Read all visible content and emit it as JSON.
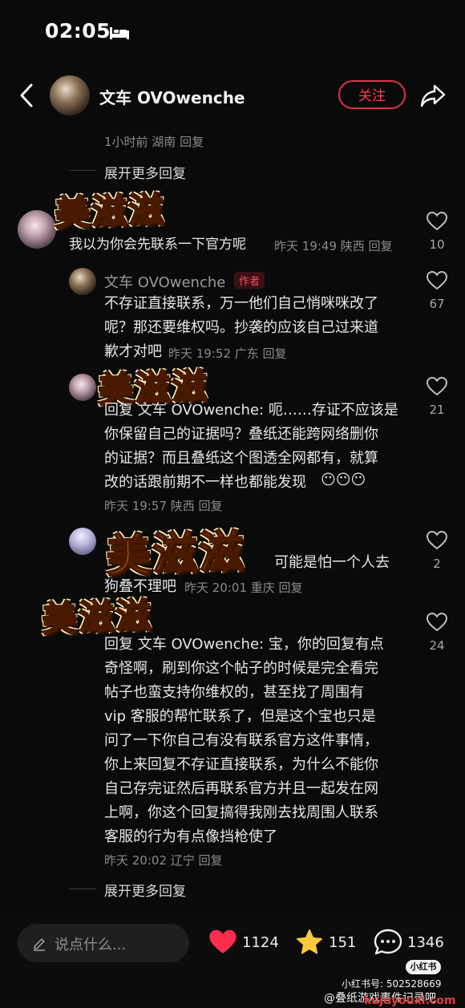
{
  "status": {
    "time": "02:05"
  },
  "header": {
    "name": "文车 OVOwenche",
    "follow": "关注"
  },
  "top_meta": "1小时前 湖南 回复",
  "expand_top": "展开更多回复",
  "comments": [
    {
      "sticker": "美滋滋",
      "text": "我以为你会先联系一下官方呢",
      "meta": "昨天 19:49 陕西 回复",
      "likes": "10"
    },
    {
      "name": "文车 OVOwenche",
      "badge": "作者",
      "lines": [
        "不存证直接联系，万一他们自己悄咪咪改了",
        "呢？那还要维权吗。抄袭的应该自己过来道",
        "歉才对吧"
      ],
      "meta": "昨天 19:52 广东 回复",
      "likes": "67"
    },
    {
      "sticker": "美滋滋",
      "lines": [
        "回复 文车 OVOwenche: 呃……存证不应该是",
        "你保留自己的证据吗？叠纸还能跨网络删你",
        "的证据？而且叠纸这个图透全网都有，就算",
        "改的话跟前期不一样也都能发现"
      ],
      "emojis": "😶😶😶",
      "meta": "昨天 19:57 陕西 回复",
      "likes": "21"
    },
    {
      "sticker": "美滋滋",
      "lines": [
        "可能是怕一个人去",
        "狗叠不理吧"
      ],
      "meta": "昨天 20:01 重庆 回复",
      "likes": "2"
    },
    {
      "sticker": "美滋滋",
      "lines": [
        "回复 文车 OVOwenche: 宝，你的回复有点",
        "奇怪啊，刷到你这个帖子的时候是完全看完",
        "帖子也蛮支持你维权的，甚至找了周围有",
        "vip 客服的帮忙联系了，但是这个宝也只是",
        "问了一下你自己有没有联系官方这件事情，",
        "你上来回复不存证直接联系，为什么不能你",
        "自己存完证然后再联系官方并且一起发在网",
        "上啊，你这个回复搞得我刚去找周围人联系",
        "客服的行为有点像挡枪使了"
      ],
      "meta": "昨天 20:02 辽宁 回复",
      "likes": "24"
    }
  ],
  "expand_bottom": "展开更多回复",
  "bottom_bar": {
    "placeholder": "说点什么...",
    "likes": "1124",
    "stars": "151",
    "comments": "1346"
  },
  "watermark": {
    "badge": "小红书",
    "id": "小红书号: 502528669",
    "line": "@叠纸游戏事件记录吧",
    "url": "kujuyouxi.com"
  },
  "colors": {
    "accent": "#ff3d57",
    "heart": "#ff2e4d",
    "star": "#ffc93c",
    "sticker": "#ffa320"
  }
}
